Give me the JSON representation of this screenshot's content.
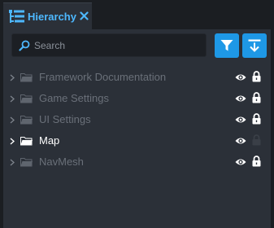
{
  "tab": {
    "title": "Hierarchy",
    "icon": "hierarchy-icon",
    "close_icon": "close-icon"
  },
  "search": {
    "placeholder": "Search",
    "value": ""
  },
  "toolbar": {
    "filter_icon": "filter-icon",
    "collapse_icon": "collapse-all-icon"
  },
  "items": [
    {
      "label": "Framework Documentation",
      "active": false,
      "visible": true,
      "locked": true
    },
    {
      "label": "Game Settings",
      "active": false,
      "visible": true,
      "locked": true
    },
    {
      "label": "UI Settings",
      "active": false,
      "visible": true,
      "locked": true
    },
    {
      "label": "Map",
      "active": true,
      "visible": true,
      "locked": false
    },
    {
      "label": "NavMesh",
      "active": false,
      "visible": true,
      "locked": true
    }
  ],
  "colors": {
    "accent": "#1e98e6",
    "tab_title": "#4db8ff",
    "panel_bg": "#2b3038",
    "outer_bg": "#1b1e22",
    "dim_text": "#6a7079",
    "active_text": "#ffffff"
  }
}
